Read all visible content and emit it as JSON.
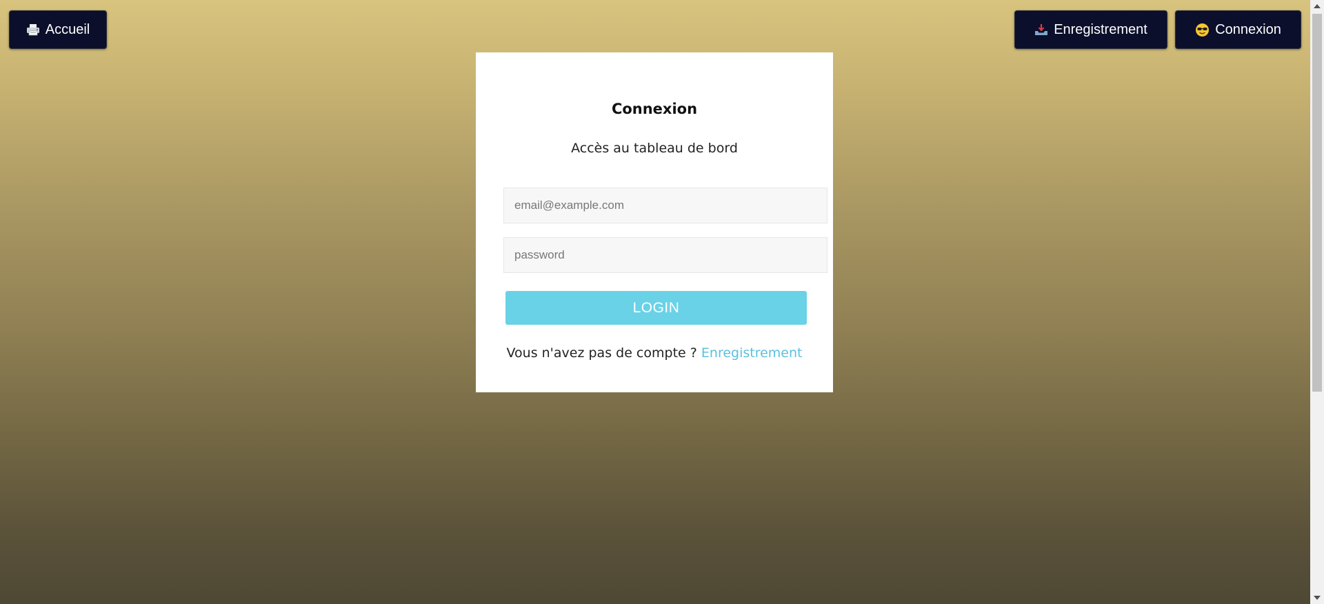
{
  "nav": {
    "home": {
      "label": "Accueil",
      "icon": "printer-icon"
    },
    "register": {
      "label": "Enregistrement",
      "icon": "inbox-tray-icon"
    },
    "login": {
      "label": "Connexion",
      "icon": "sunglasses-face-icon"
    }
  },
  "card": {
    "title": "Connexion",
    "subtitle": "Accès au tableau de bord",
    "email_placeholder": "email@example.com",
    "password_placeholder": "password",
    "login_label": "LOGIN",
    "footer_text": "Vous n'avez pas de compte ?",
    "footer_link": "Enregistrement"
  },
  "colors": {
    "nav_button_bg": "#0b0f2b",
    "login_button": "#69d2e7",
    "link": "#5bc0de",
    "bg_top": "#d8c47e",
    "bg_bottom": "#4e4834"
  }
}
